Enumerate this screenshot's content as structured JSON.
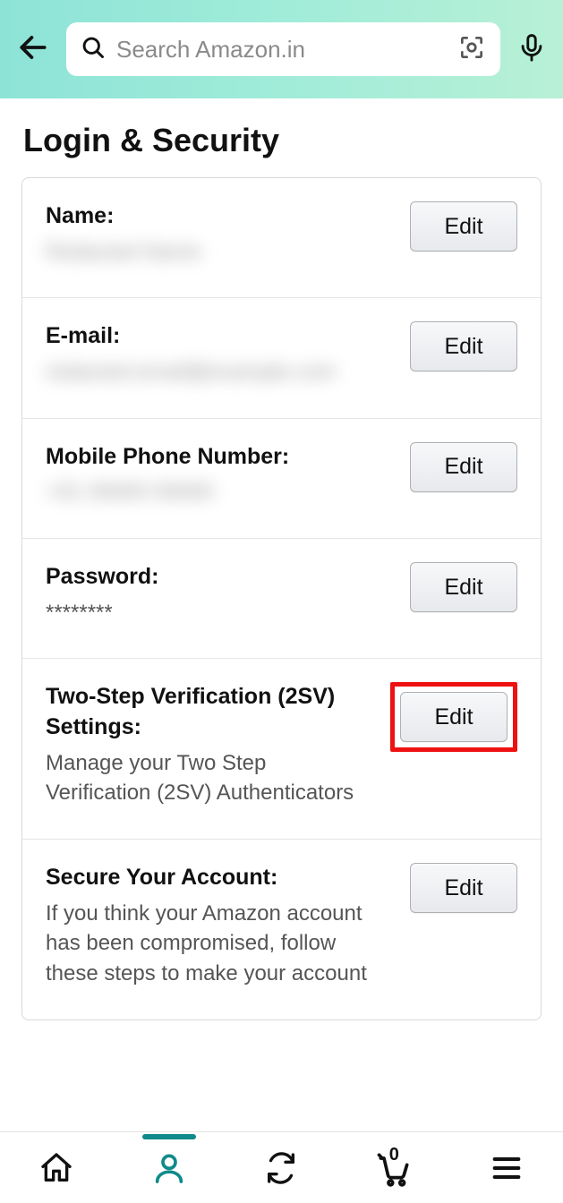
{
  "header": {
    "search_placeholder": "Search Amazon.in"
  },
  "page": {
    "title": "Login & Security"
  },
  "buttons": {
    "edit": "Edit"
  },
  "rows": {
    "name": {
      "label": "Name:",
      "value": "Redacted Name"
    },
    "email": {
      "label": "E-mail:",
      "value": "redacted.email@example.com"
    },
    "mobile": {
      "label": "Mobile Phone Number:",
      "value": "+91 00000 00000"
    },
    "password": {
      "label": "Password:",
      "value": "********"
    },
    "twosv": {
      "label": "Two-Step Verification (2SV) Settings:",
      "desc": "Manage your Two Step Verification (2SV) Authenticators"
    },
    "secure": {
      "label": "Secure Your Account:",
      "desc": "If you think your Amazon account has been compromised, follow these steps to make your account"
    }
  },
  "nav": {
    "cart_count": "0"
  }
}
